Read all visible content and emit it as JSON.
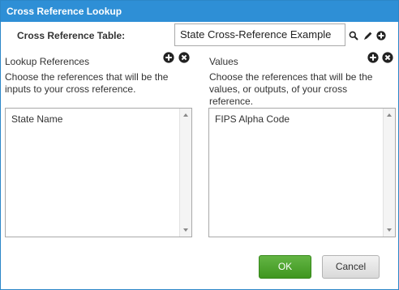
{
  "dialog": {
    "title": "Cross Reference Lookup"
  },
  "xref": {
    "label": "Cross Reference Table:",
    "value": "State Cross-Reference Example",
    "icons": [
      "search-icon",
      "edit-icon",
      "add-icon"
    ]
  },
  "lookup": {
    "title": "Lookup References",
    "description_line1": "Choose the references that will be the",
    "description_line2": "inputs to your cross reference.",
    "items": [
      "State Name"
    ]
  },
  "values": {
    "title": "Values",
    "description_line1": "Choose the references that will be the",
    "description_line2": "values, or outputs, of your cross",
    "description_line3": "reference.",
    "items": [
      "FIPS Alpha Code"
    ]
  },
  "buttons": {
    "ok_label": "OK",
    "cancel_label": "Cancel"
  },
  "colors": {
    "titlebar": "#2e8fd6",
    "ok_button": "#4ca52b",
    "cancel_button": "#e5e5e5"
  }
}
